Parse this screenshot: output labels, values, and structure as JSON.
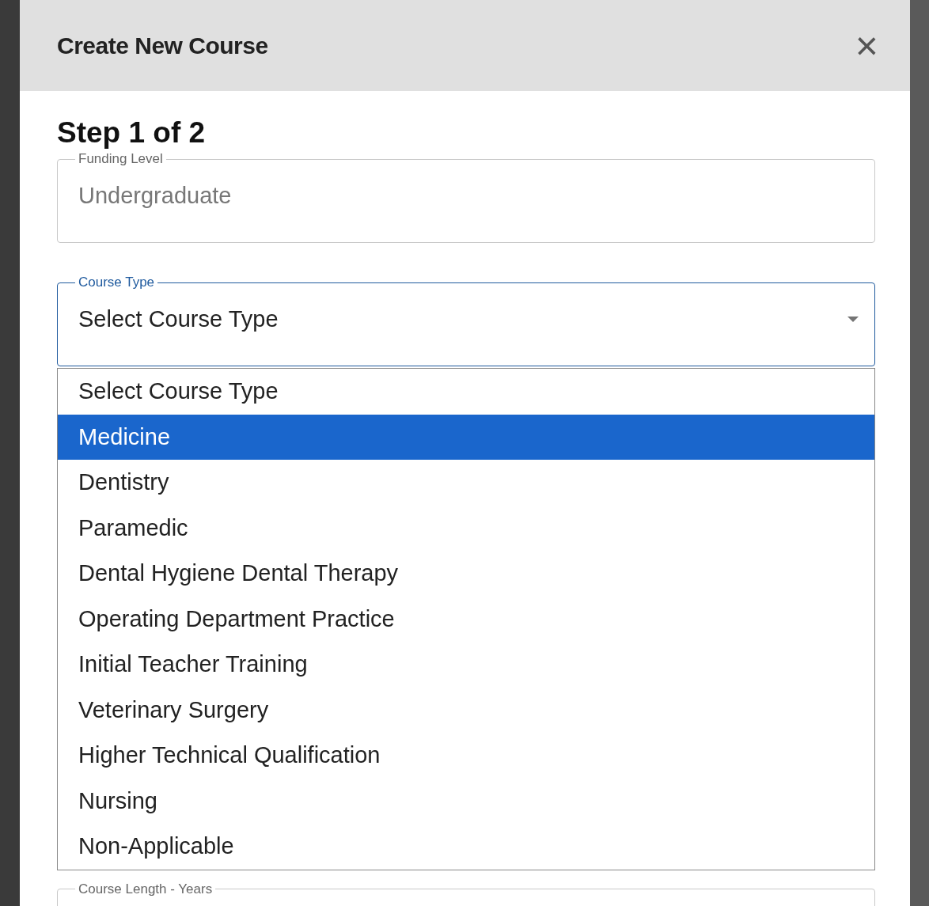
{
  "dialog": {
    "title": "Create New Course",
    "close": "×"
  },
  "step": "Step 1 of 2",
  "fields": [
    {
      "label": "Funding Level",
      "value": "Undergraduate",
      "disabled": true,
      "focused": false,
      "kind": "text"
    },
    {
      "label": "Course Type",
      "value": "Select Course Type",
      "disabled": false,
      "focused": true,
      "kind": "select"
    }
  ],
  "options": [
    {
      "label": "Select Course Type",
      "selected": false
    },
    {
      "label": "Medicine",
      "selected": true
    },
    {
      "label": "Dentistry",
      "selected": false
    },
    {
      "label": "Paramedic",
      "selected": false
    },
    {
      "label": "Dental Hygiene Dental Therapy",
      "selected": false
    },
    {
      "label": "Operating Department Practice",
      "selected": false
    },
    {
      "label": "Initial Teacher Training",
      "selected": false
    },
    {
      "label": "Veterinary Surgery",
      "selected": false
    },
    {
      "label": "Higher Technical Qualification",
      "selected": false
    },
    {
      "label": "Nursing",
      "selected": false
    },
    {
      "label": "Non-Applicable",
      "selected": false
    }
  ],
  "next_field": {
    "label": "Course Length - Years"
  }
}
